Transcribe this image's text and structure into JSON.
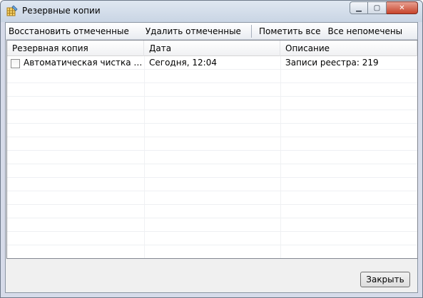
{
  "window": {
    "title": "Резервные копии",
    "icon": "registry-backup-icon"
  },
  "caption_buttons": {
    "minimize": "minimize-icon",
    "maximize": "maximize-icon",
    "close": "close-icon"
  },
  "toolbar": {
    "restore_label": "Восстановить отмеченные",
    "delete_label": "Удалить отмеченные",
    "check_all_label": "Пометить все",
    "uncheck_all_label": "Все непомечены"
  },
  "table": {
    "columns": [
      "Резервная копия",
      "Дата",
      "Описание"
    ],
    "rows": [
      {
        "checked": false,
        "name": "Автоматическая чистка реестра",
        "date": "Сегодня, 12:04",
        "description": "Записи реестра: 219"
      }
    ]
  },
  "footer": {
    "close_label": "Закрыть"
  },
  "colors": {
    "window_frame": "#d6dbe9",
    "client_bg": "#f0f0f0",
    "close_caption": "#c7432a"
  }
}
